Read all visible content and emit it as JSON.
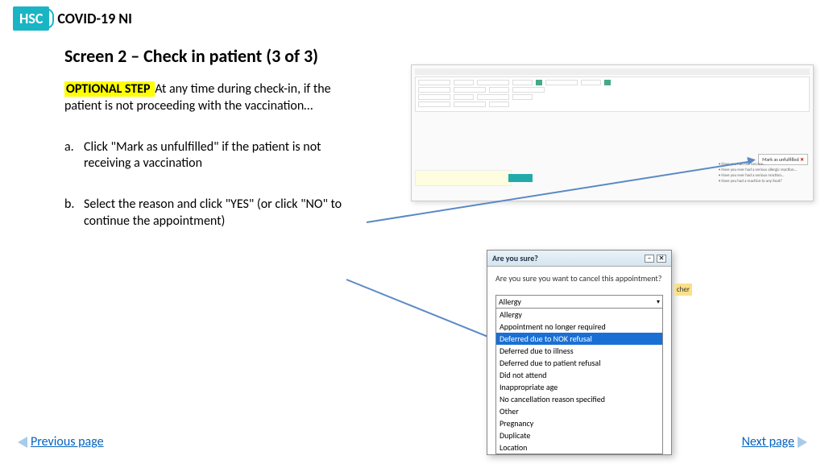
{
  "header": {
    "logo_text": "HSC",
    "title": "COVID-19 NI"
  },
  "page_title": "Screen 2 – Check in patient (3 of 3)",
  "intro": {
    "highlight": " OPTIONAL STEP ",
    "rest": " At any time during check-in, if the patient is not proceeding with the vaccination…"
  },
  "steps": [
    {
      "marker": "a.",
      "text": "Click \"Mark as unfulfilled\" if the patient is not receiving a vaccination"
    },
    {
      "marker": "b.",
      "text": "Select the reason and click \"YES\" (or click \"NO\" to continue the appointment)"
    }
  ],
  "screenshot_top": {
    "button_label": "Mark as unfulfilled",
    "bullets": [
      "Have you had the vaccine…",
      "Have you ever had a serious allergic reaction…",
      "Have you ever had a serious reaction…",
      "Have you had a reaction to any food?"
    ]
  },
  "dialog": {
    "title": "Are you sure?",
    "body": "Are you sure you want to cancel this appointment?",
    "selected": "Allergy",
    "options": [
      "Allergy",
      "Appointment no longer required",
      "Deferred due to NOK refusal",
      "Deferred due to illness",
      "Deferred due to patient refusal",
      "Did not attend",
      "Inappropriate age",
      "No cancellation reason specified",
      "Other",
      "Pregnancy",
      "Duplicate",
      "Location"
    ],
    "highlighted_index": 2
  },
  "footer": {
    "prev": "Previous page",
    "next": "Next page"
  },
  "cher_tag": "cher"
}
